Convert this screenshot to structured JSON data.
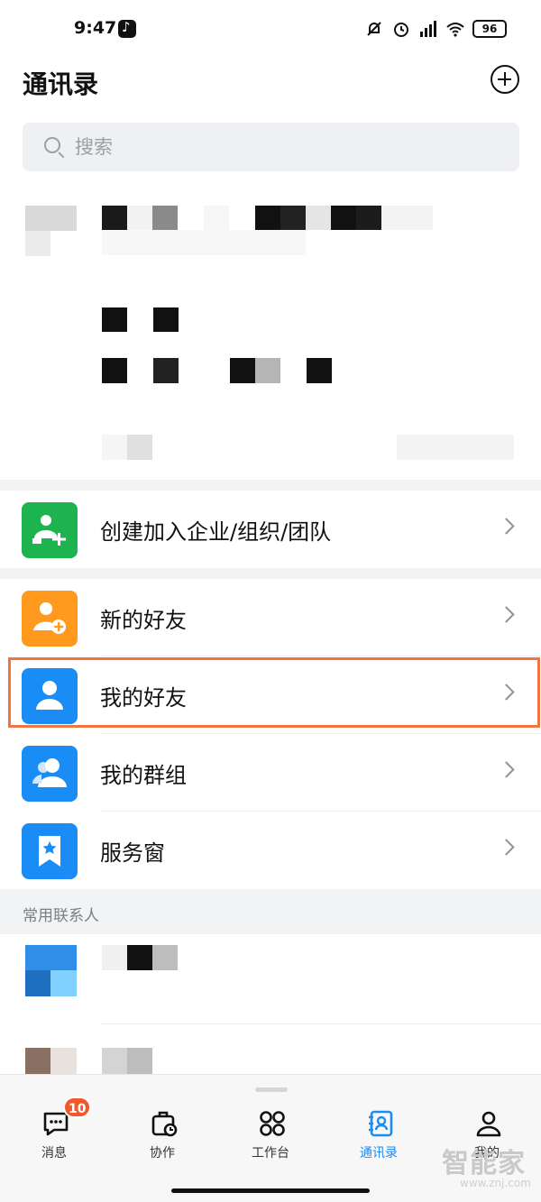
{
  "status_bar": {
    "time": "9:47",
    "battery": "96"
  },
  "header": {
    "title": "通讯录"
  },
  "search": {
    "placeholder": "搜索"
  },
  "menu_items": [
    {
      "label": "创建加入企业/组织/团队",
      "color": "#1db34e",
      "icon": "create-org-icon"
    },
    {
      "label": "新的好友",
      "color": "#ff9a1f",
      "icon": "add-friend-icon"
    },
    {
      "label": "我的好友",
      "color": "#1a8cf5",
      "icon": "friend-icon"
    },
    {
      "label": "我的群组",
      "color": "#1a8cf5",
      "icon": "group-icon"
    },
    {
      "label": "服务窗",
      "color": "#1a8cf5",
      "icon": "bookmark-star-icon"
    }
  ],
  "frequent_contacts": {
    "title": "常用联系人"
  },
  "bottom_nav": [
    {
      "label": "消息",
      "icon": "message-icon",
      "badge": "10"
    },
    {
      "label": "协作",
      "icon": "collab-icon"
    },
    {
      "label": "工作台",
      "icon": "workbench-icon"
    },
    {
      "label": "通讯录",
      "icon": "contacts-icon",
      "active": true
    },
    {
      "label": "我的",
      "icon": "profile-icon"
    }
  ],
  "watermark": {
    "text": "智能家",
    "url": "www.znj.com"
  },
  "colors": {
    "accent": "#1a8cf5",
    "highlight": "#f2743f",
    "badge": "#f2582b"
  }
}
